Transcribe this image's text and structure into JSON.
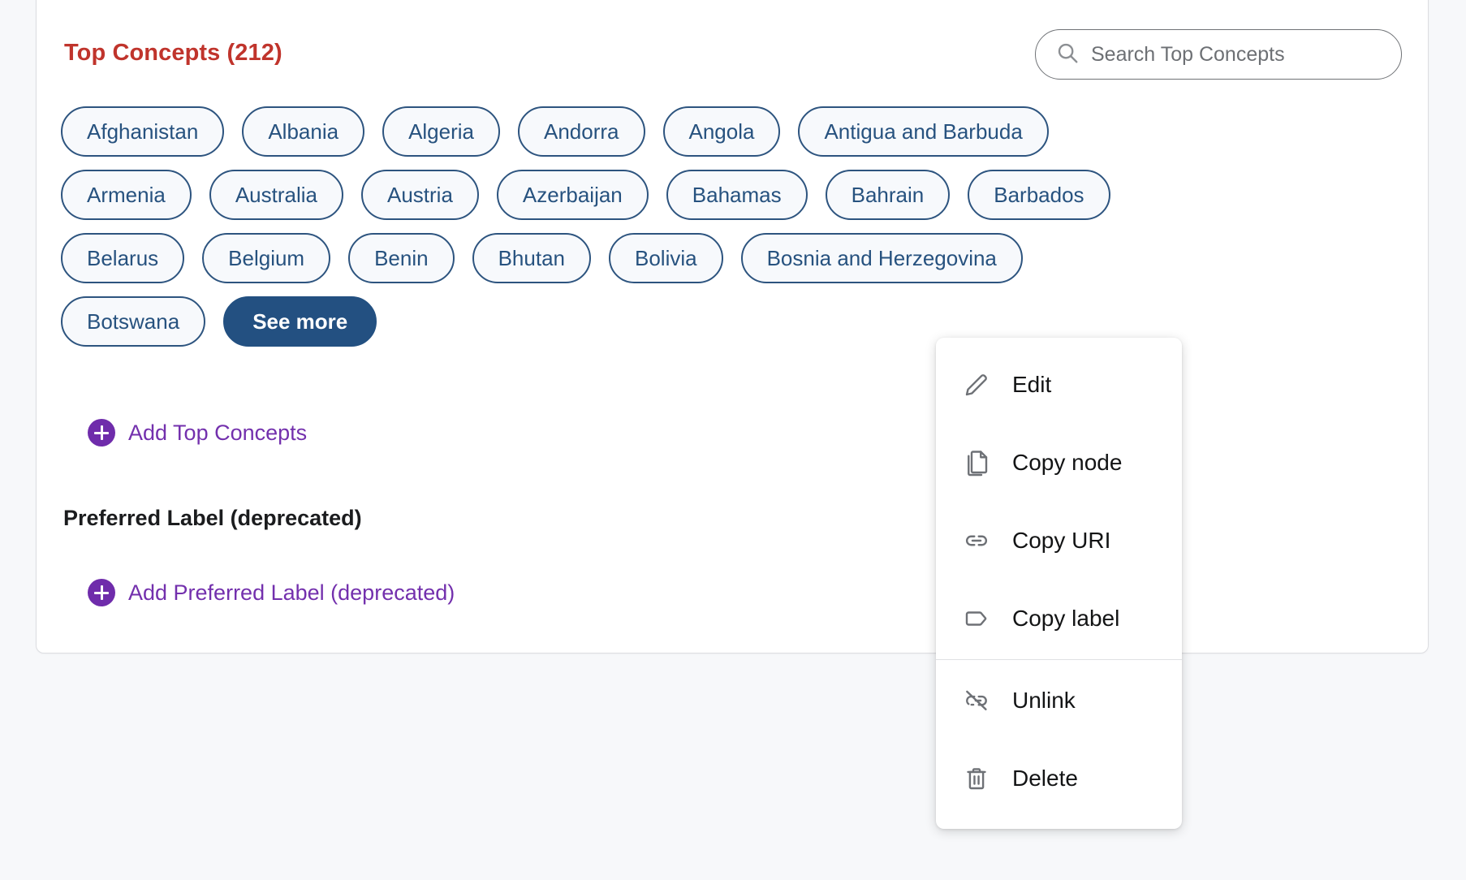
{
  "section": {
    "title": "Top Concepts (212)",
    "title_color": "#c0342c"
  },
  "search": {
    "placeholder": "Search Top Concepts",
    "value": "",
    "icon": "search-icon"
  },
  "chips": {
    "rows": [
      [
        "Afghanistan",
        "Albania",
        "Algeria",
        "Andorra",
        "Angola",
        "Antigua and Barbuda"
      ],
      [
        "Armenia",
        "Australia",
        "Austria",
        "Azerbaijan",
        "Bahamas",
        "Bahrain",
        "Barbados"
      ],
      [
        "Belarus",
        "Belgium",
        "Benin",
        "Bhutan",
        "Bolivia",
        "Bosnia and Herzegovina"
      ],
      [
        "Botswana"
      ]
    ],
    "see_more_label": "See more",
    "border_color": "#2d547f",
    "text_color": "#27527f",
    "fill_color": "#f7f9fc",
    "see_more_fill": "#235081"
  },
  "actions": {
    "add_top_concepts": "Add Top Concepts",
    "add_preferred_label": "Add Preferred Label (deprecated)",
    "link_color": "#7330ad",
    "plus_icon": "plus-circle-icon"
  },
  "preferred_label_section": {
    "heading": "Preferred Label (deprecated)"
  },
  "context_menu": {
    "items": [
      {
        "label": "Edit",
        "icon": "pencil-icon"
      },
      {
        "label": "Copy node",
        "icon": "copy-pages-icon"
      },
      {
        "label": "Copy URI",
        "icon": "link-icon"
      },
      {
        "label": "Copy label",
        "icon": "tag-icon"
      },
      {
        "label": "Unlink",
        "icon": "unlink-icon"
      },
      {
        "label": "Delete",
        "icon": "trash-icon"
      }
    ],
    "divider_after_index": 3
  }
}
